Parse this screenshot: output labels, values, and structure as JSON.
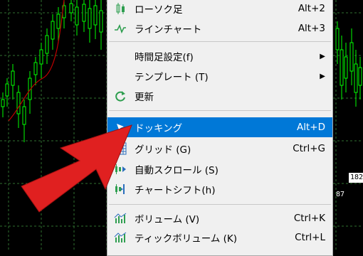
{
  "colors": {
    "chart_bg": "#000000",
    "grid": "#2f6f2f",
    "candle": "#00ff00",
    "ma_line": "#c00000",
    "menu_bg": "#f0f0f0",
    "highlight": "#0078d7",
    "arrow": "#e02020",
    "icon_green": "#2e9e4f",
    "icon_blue": "#2a6ebd"
  },
  "chart": {
    "price_label": "182",
    "price_label_2": "87"
  },
  "menu": {
    "items": [
      {
        "label": "ローソク足",
        "shortcut": "Alt+2",
        "icon": "candlestick-icon"
      },
      {
        "label": "ラインチャート",
        "shortcut": "Alt+3",
        "icon": "line-chart-icon"
      },
      {
        "label": "時間足設定(f)",
        "submenu": "▶"
      },
      {
        "label": "テンプレート (T)",
        "submenu": "▶"
      },
      {
        "label": "更新",
        "icon": "refresh-icon"
      },
      {
        "label": "ドッキング",
        "shortcut": "Alt+D",
        "icon": "pin-icon"
      },
      {
        "label": "グリッド (G)",
        "shortcut": "Ctrl+G",
        "icon": "grid-icon"
      },
      {
        "label": "自動スクロール (S)",
        "icon": "auto-scroll-icon"
      },
      {
        "label": "チャートシフト(h)",
        "icon": "chart-shift-icon"
      },
      {
        "label": "ボリューム (V)",
        "shortcut": "Ctrl+K",
        "icon": "volume-icon"
      },
      {
        "label": "ティックボリューム (K)",
        "shortcut": "Ctrl+L",
        "icon": "tick-volume-icon"
      }
    ]
  }
}
